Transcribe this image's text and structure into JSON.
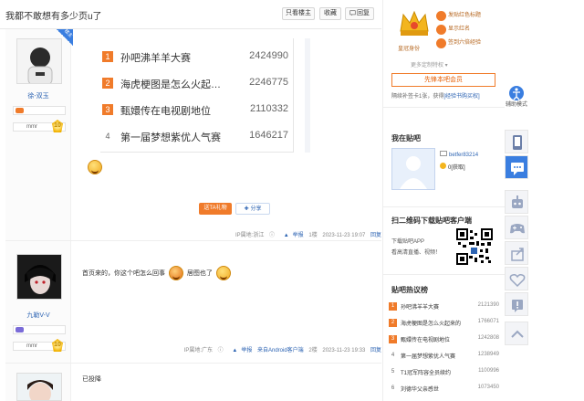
{
  "header": {
    "title": "我都不敢想有多少页u了",
    "buttons": [
      "只看楼主",
      "收藏",
      "回复"
    ]
  },
  "posts": [
    {
      "author": "徐-双玉",
      "badge": "楼主",
      "level": "10",
      "level_label": "mmr",
      "ranking": [
        {
          "rank": "1",
          "name": "孙吧沸羊羊大赛",
          "count": "2424990"
        },
        {
          "rank": "2",
          "name": "海虎梗图是怎么火起来的",
          "count": "2246775"
        },
        {
          "rank": "3",
          "name": "甄嬛传在电视剧地位",
          "count": "2110332"
        },
        {
          "rank": "4",
          "name": "第一届梦想紫优人气赛",
          "count": "1646217"
        }
      ],
      "gift_label": "送TA礼物",
      "share_label": "分享",
      "ip": "IP属地:浙江",
      "report": "举报",
      "floor": "1楼",
      "time": "2023-11-23 19:07",
      "reply": "回复"
    },
    {
      "author": "九勒V-V",
      "level": "10",
      "level_label": "mmr",
      "text_a": "首页来的，你这个吧怎么回事",
      "text_b": "居图也了",
      "ip": "IP属地:广东",
      "report": "举报",
      "source": "来自Android客户端",
      "floor": "2楼",
      "time": "2023-11-23 19:33",
      "reply": "回复"
    },
    {
      "text": "已投降"
    }
  ],
  "sidebar": {
    "crown_label": "皇冠身份",
    "privileges": [
      "发贴红色标题",
      "显示红名",
      "签到六倍经验"
    ],
    "more_label": "更多定制特权 ▾",
    "open_button": "先锋本吧会员",
    "renew_text": "隔续补签卡1张，获得",
    "renew_link": "[经验书购买权]",
    "my_bar_title": "我在贴吧",
    "my_name": "betfer83214",
    "my_rep": "0[获取]",
    "download_title": "扫二维码下载贴吧客户端",
    "download_line1": "下载贴吧APP",
    "download_line2": "看高清直播、视频！",
    "hot_title": "贴吧热议榜",
    "hot": [
      {
        "rank": "1",
        "name": "孙吧沸羊羊大赛",
        "count": "2121390"
      },
      {
        "rank": "2",
        "name": "海虎梗图是怎么火起来的",
        "count": "1766071"
      },
      {
        "rank": "3",
        "name": "甄嬛传在电视剧地位",
        "count": "1242808"
      },
      {
        "rank": "4",
        "name": "第一届梦想紫优人气赛",
        "count": "1238949"
      },
      {
        "rank": "5",
        "name": "T1冠军阵容全员续约",
        "count": "1100996"
      },
      {
        "rank": "6",
        "name": "刘德华父亲感世",
        "count": "1073450"
      }
    ]
  },
  "toolbar": {
    "assist_label": "辅助模式"
  },
  "colors": {
    "rank_orange": "#f07b2a",
    "link_blue": "#2d64b3",
    "accent_blue": "#3a7ee0"
  }
}
